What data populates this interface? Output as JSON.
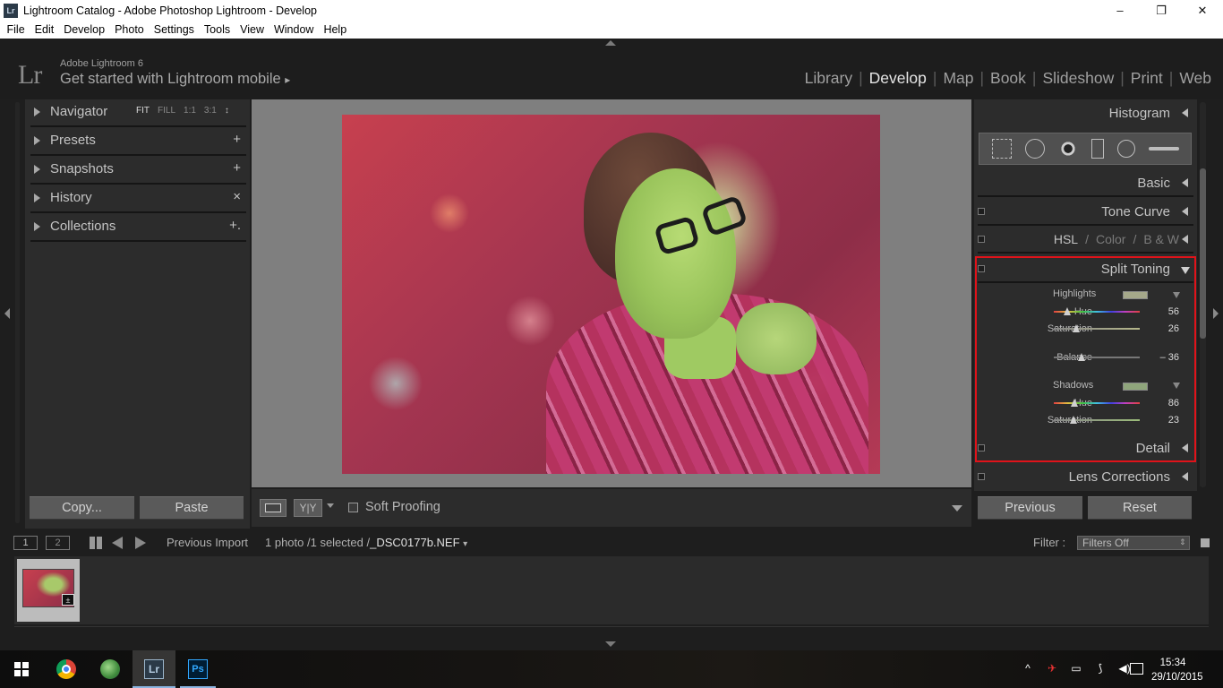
{
  "window": {
    "app_icon": "Lr",
    "title": "Lightroom Catalog - Adobe Photoshop Lightroom - Develop",
    "controls": [
      "–",
      "❐",
      "✕"
    ]
  },
  "menu": [
    "File",
    "Edit",
    "Develop",
    "Photo",
    "Settings",
    "Tools",
    "View",
    "Window",
    "Help"
  ],
  "identity": {
    "logo": "Lr",
    "brand": "Adobe Lightroom 6",
    "mobile": "Get started with Lightroom mobile",
    "mobile_arrow": "▸"
  },
  "modules": {
    "items": [
      "Library",
      "Develop",
      "Map",
      "Book",
      "Slideshow",
      "Print",
      "Web"
    ],
    "separator": "|",
    "active": "Develop"
  },
  "left_panel": {
    "navigator": {
      "label": "Navigator",
      "zooms": [
        "FIT",
        "FILL",
        "1:1",
        "3:1"
      ],
      "zoom_caret": "↕"
    },
    "presets": {
      "label": "Presets",
      "action": "+"
    },
    "snapshots": {
      "label": "Snapshots",
      "action": "+"
    },
    "history": {
      "label": "History",
      "action": "×"
    },
    "collections": {
      "label": "Collections",
      "action": "+."
    },
    "copy_button": "Copy...",
    "paste_button": "Paste"
  },
  "toolbar": {
    "yy_label": "Y|Y",
    "soft_proofing": "Soft Proofing",
    "soft_proofing_checked": false
  },
  "right_panel": {
    "histogram": "Histogram",
    "basic": "Basic",
    "tone_curve": "Tone Curve",
    "hsl": {
      "hsl": "HSL",
      "sep": "/",
      "color": "Color",
      "bw": "B & W"
    },
    "split_toning": {
      "title": "Split Toning",
      "highlights": {
        "label": "Highlights",
        "swatch_color": "#a5a88a",
        "hue_label": "Hue",
        "hue_value": "56",
        "hue_fraction": 0.155,
        "saturation_label": "Saturation",
        "saturation_value": "26",
        "saturation_fraction": 0.26
      },
      "balance": {
        "label": "Balance",
        "value": "– 36",
        "fraction": 0.32
      },
      "shadows": {
        "label": "Shadows",
        "swatch_color": "#8fa57b",
        "hue_label": "Hue",
        "hue_value": "86",
        "hue_fraction": 0.239,
        "saturation_label": "Saturation",
        "saturation_value": "23",
        "saturation_fraction": 0.23
      }
    },
    "detail": "Detail",
    "lens_corrections": "Lens Corrections",
    "previous_button": "Previous",
    "reset_button": "Reset"
  },
  "filmstrip": {
    "view1": "1",
    "view2": "2",
    "source": "Previous Import",
    "status_prefix": "1 photo /1 selected /",
    "filename": "_DSC0177b.NEF",
    "filename_caret": "▾",
    "filter_label": "Filter :",
    "filter_value": "Filters Off",
    "filter_caret": "⇕",
    "thumb_badge": "±"
  },
  "taskbar": {
    "apps": [
      "chrome",
      "globe",
      "lightroom",
      "photoshop"
    ],
    "lr_label": "Lr",
    "ps_label": "Ps",
    "tray_icons": [
      "^",
      "✈",
      "▭",
      "⟆",
      "◀)"
    ],
    "time": "15:34",
    "date": "29/10/2015"
  }
}
